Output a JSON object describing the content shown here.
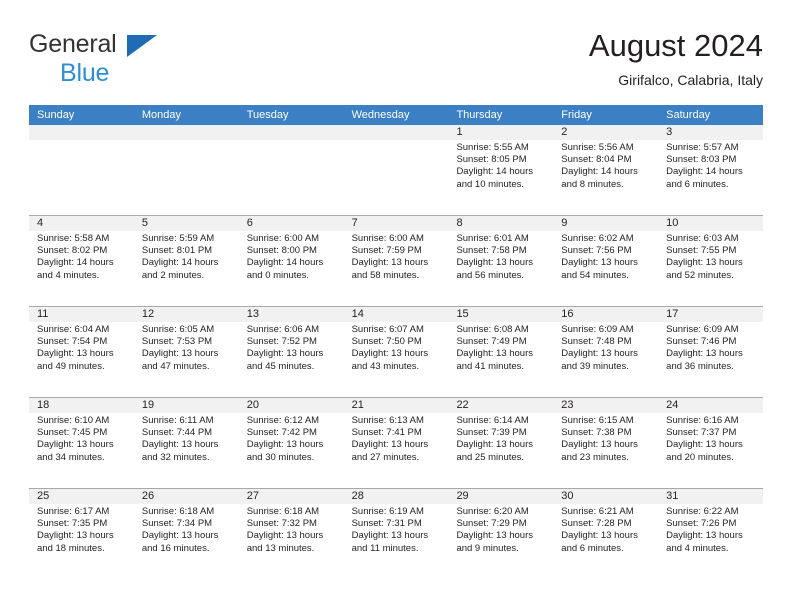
{
  "brand": {
    "name_part1": "General",
    "name_part2": "Blue"
  },
  "header": {
    "title": "August 2024",
    "subtitle": "Girifalco, Calabria, Italy"
  },
  "colors": {
    "header_blue": "#3b80c4",
    "brand_blue": "#2b8fd4",
    "daynum_band": "#f1f1f1",
    "divider": "#a9a9a9",
    "text": "#231f20"
  },
  "weekdays": [
    "Sunday",
    "Monday",
    "Tuesday",
    "Wednesday",
    "Thursday",
    "Friday",
    "Saturday"
  ],
  "labels": {
    "sunrise_prefix": "Sunrise:",
    "sunset_prefix": "Sunset:",
    "daylight_prefix": "Daylight:"
  },
  "weeks": [
    [
      {
        "day": "",
        "sunrise": "",
        "sunset": "",
        "daylight_line1": "",
        "daylight_line2": "",
        "empty": true
      },
      {
        "day": "",
        "sunrise": "",
        "sunset": "",
        "daylight_line1": "",
        "daylight_line2": "",
        "empty": true
      },
      {
        "day": "",
        "sunrise": "",
        "sunset": "",
        "daylight_line1": "",
        "daylight_line2": "",
        "empty": true
      },
      {
        "day": "",
        "sunrise": "",
        "sunset": "",
        "daylight_line1": "",
        "daylight_line2": "",
        "empty": true
      },
      {
        "day": "1",
        "sunrise": "Sunrise: 5:55 AM",
        "sunset": "Sunset: 8:05 PM",
        "daylight_line1": "Daylight: 14 hours",
        "daylight_line2": "and 10 minutes."
      },
      {
        "day": "2",
        "sunrise": "Sunrise: 5:56 AM",
        "sunset": "Sunset: 8:04 PM",
        "daylight_line1": "Daylight: 14 hours",
        "daylight_line2": "and 8 minutes."
      },
      {
        "day": "3",
        "sunrise": "Sunrise: 5:57 AM",
        "sunset": "Sunset: 8:03 PM",
        "daylight_line1": "Daylight: 14 hours",
        "daylight_line2": "and 6 minutes."
      }
    ],
    [
      {
        "day": "4",
        "sunrise": "Sunrise: 5:58 AM",
        "sunset": "Sunset: 8:02 PM",
        "daylight_line1": "Daylight: 14 hours",
        "daylight_line2": "and 4 minutes."
      },
      {
        "day": "5",
        "sunrise": "Sunrise: 5:59 AM",
        "sunset": "Sunset: 8:01 PM",
        "daylight_line1": "Daylight: 14 hours",
        "daylight_line2": "and 2 minutes."
      },
      {
        "day": "6",
        "sunrise": "Sunrise: 6:00 AM",
        "sunset": "Sunset: 8:00 PM",
        "daylight_line1": "Daylight: 14 hours",
        "daylight_line2": "and 0 minutes."
      },
      {
        "day": "7",
        "sunrise": "Sunrise: 6:00 AM",
        "sunset": "Sunset: 7:59 PM",
        "daylight_line1": "Daylight: 13 hours",
        "daylight_line2": "and 58 minutes."
      },
      {
        "day": "8",
        "sunrise": "Sunrise: 6:01 AM",
        "sunset": "Sunset: 7:58 PM",
        "daylight_line1": "Daylight: 13 hours",
        "daylight_line2": "and 56 minutes."
      },
      {
        "day": "9",
        "sunrise": "Sunrise: 6:02 AM",
        "sunset": "Sunset: 7:56 PM",
        "daylight_line1": "Daylight: 13 hours",
        "daylight_line2": "and 54 minutes."
      },
      {
        "day": "10",
        "sunrise": "Sunrise: 6:03 AM",
        "sunset": "Sunset: 7:55 PM",
        "daylight_line1": "Daylight: 13 hours",
        "daylight_line2": "and 52 minutes."
      }
    ],
    [
      {
        "day": "11",
        "sunrise": "Sunrise: 6:04 AM",
        "sunset": "Sunset: 7:54 PM",
        "daylight_line1": "Daylight: 13 hours",
        "daylight_line2": "and 49 minutes."
      },
      {
        "day": "12",
        "sunrise": "Sunrise: 6:05 AM",
        "sunset": "Sunset: 7:53 PM",
        "daylight_line1": "Daylight: 13 hours",
        "daylight_line2": "and 47 minutes."
      },
      {
        "day": "13",
        "sunrise": "Sunrise: 6:06 AM",
        "sunset": "Sunset: 7:52 PM",
        "daylight_line1": "Daylight: 13 hours",
        "daylight_line2": "and 45 minutes."
      },
      {
        "day": "14",
        "sunrise": "Sunrise: 6:07 AM",
        "sunset": "Sunset: 7:50 PM",
        "daylight_line1": "Daylight: 13 hours",
        "daylight_line2": "and 43 minutes."
      },
      {
        "day": "15",
        "sunrise": "Sunrise: 6:08 AM",
        "sunset": "Sunset: 7:49 PM",
        "daylight_line1": "Daylight: 13 hours",
        "daylight_line2": "and 41 minutes."
      },
      {
        "day": "16",
        "sunrise": "Sunrise: 6:09 AM",
        "sunset": "Sunset: 7:48 PM",
        "daylight_line1": "Daylight: 13 hours",
        "daylight_line2": "and 39 minutes."
      },
      {
        "day": "17",
        "sunrise": "Sunrise: 6:09 AM",
        "sunset": "Sunset: 7:46 PM",
        "daylight_line1": "Daylight: 13 hours",
        "daylight_line2": "and 36 minutes."
      }
    ],
    [
      {
        "day": "18",
        "sunrise": "Sunrise: 6:10 AM",
        "sunset": "Sunset: 7:45 PM",
        "daylight_line1": "Daylight: 13 hours",
        "daylight_line2": "and 34 minutes."
      },
      {
        "day": "19",
        "sunrise": "Sunrise: 6:11 AM",
        "sunset": "Sunset: 7:44 PM",
        "daylight_line1": "Daylight: 13 hours",
        "daylight_line2": "and 32 minutes."
      },
      {
        "day": "20",
        "sunrise": "Sunrise: 6:12 AM",
        "sunset": "Sunset: 7:42 PM",
        "daylight_line1": "Daylight: 13 hours",
        "daylight_line2": "and 30 minutes."
      },
      {
        "day": "21",
        "sunrise": "Sunrise: 6:13 AM",
        "sunset": "Sunset: 7:41 PM",
        "daylight_line1": "Daylight: 13 hours",
        "daylight_line2": "and 27 minutes."
      },
      {
        "day": "22",
        "sunrise": "Sunrise: 6:14 AM",
        "sunset": "Sunset: 7:39 PM",
        "daylight_line1": "Daylight: 13 hours",
        "daylight_line2": "and 25 minutes."
      },
      {
        "day": "23",
        "sunrise": "Sunrise: 6:15 AM",
        "sunset": "Sunset: 7:38 PM",
        "daylight_line1": "Daylight: 13 hours",
        "daylight_line2": "and 23 minutes."
      },
      {
        "day": "24",
        "sunrise": "Sunrise: 6:16 AM",
        "sunset": "Sunset: 7:37 PM",
        "daylight_line1": "Daylight: 13 hours",
        "daylight_line2": "and 20 minutes."
      }
    ],
    [
      {
        "day": "25",
        "sunrise": "Sunrise: 6:17 AM",
        "sunset": "Sunset: 7:35 PM",
        "daylight_line1": "Daylight: 13 hours",
        "daylight_line2": "and 18 minutes."
      },
      {
        "day": "26",
        "sunrise": "Sunrise: 6:18 AM",
        "sunset": "Sunset: 7:34 PM",
        "daylight_line1": "Daylight: 13 hours",
        "daylight_line2": "and 16 minutes."
      },
      {
        "day": "27",
        "sunrise": "Sunrise: 6:18 AM",
        "sunset": "Sunset: 7:32 PM",
        "daylight_line1": "Daylight: 13 hours",
        "daylight_line2": "and 13 minutes."
      },
      {
        "day": "28",
        "sunrise": "Sunrise: 6:19 AM",
        "sunset": "Sunset: 7:31 PM",
        "daylight_line1": "Daylight: 13 hours",
        "daylight_line2": "and 11 minutes."
      },
      {
        "day": "29",
        "sunrise": "Sunrise: 6:20 AM",
        "sunset": "Sunset: 7:29 PM",
        "daylight_line1": "Daylight: 13 hours",
        "daylight_line2": "and 9 minutes."
      },
      {
        "day": "30",
        "sunrise": "Sunrise: 6:21 AM",
        "sunset": "Sunset: 7:28 PM",
        "daylight_line1": "Daylight: 13 hours",
        "daylight_line2": "and 6 minutes."
      },
      {
        "day": "31",
        "sunrise": "Sunrise: 6:22 AM",
        "sunset": "Sunset: 7:26 PM",
        "daylight_line1": "Daylight: 13 hours",
        "daylight_line2": "and 4 minutes."
      }
    ]
  ]
}
